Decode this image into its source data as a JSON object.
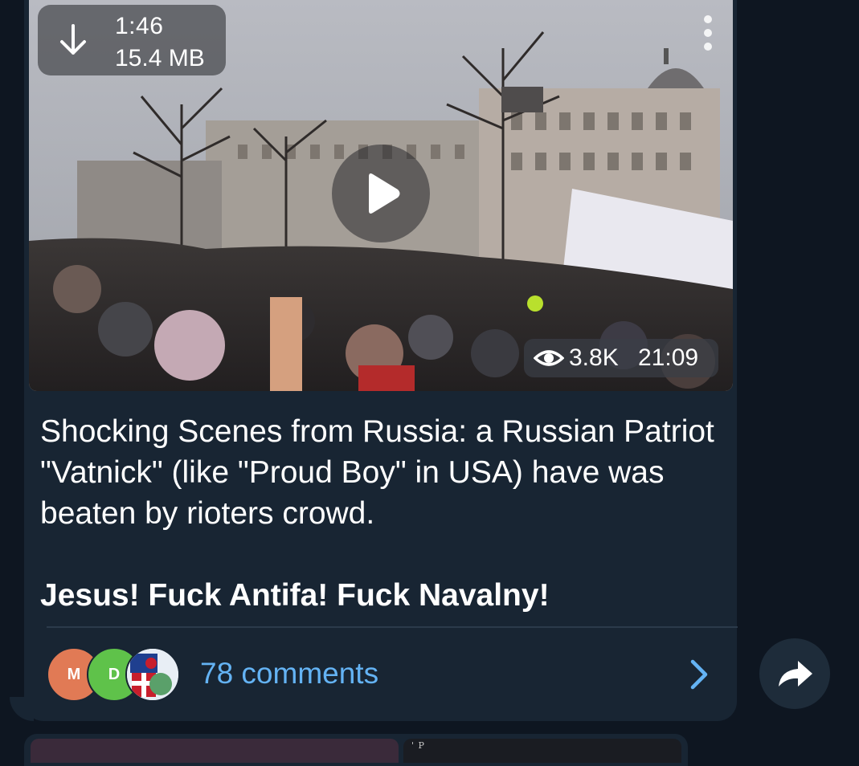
{
  "message": {
    "video": {
      "duration": "1:46",
      "file_size": "15.4 MB",
      "views": "3.8K",
      "time": "21:09",
      "download_icon": "download-arrow-icon",
      "menu_icon": "more-vertical-icon",
      "play_icon": "play-icon",
      "views_icon": "eye-icon"
    },
    "caption": {
      "text": "Shocking Scenes from Russia: a Russian Patriot \"Vatnick\" (like \"Proud Boy\" in USA) have was beaten by rioters crowd.",
      "bold_line": "Jesus! Fuck Antifa! Fuck Navalny!"
    },
    "comments": {
      "avatars": [
        {
          "initial": "M",
          "color": "#e17a55"
        },
        {
          "initial": "D",
          "color": "#5fc24a"
        },
        {
          "initial": "",
          "color": "#e8eef5"
        }
      ],
      "label": "78 comments",
      "chevron_icon": "chevron-right-icon"
    },
    "share_icon": "share-forward-icon"
  },
  "next_message": {
    "preview_text": "' P"
  },
  "colors": {
    "background": "#0e1621",
    "bubble": "#182533",
    "link": "#64b3f4"
  }
}
